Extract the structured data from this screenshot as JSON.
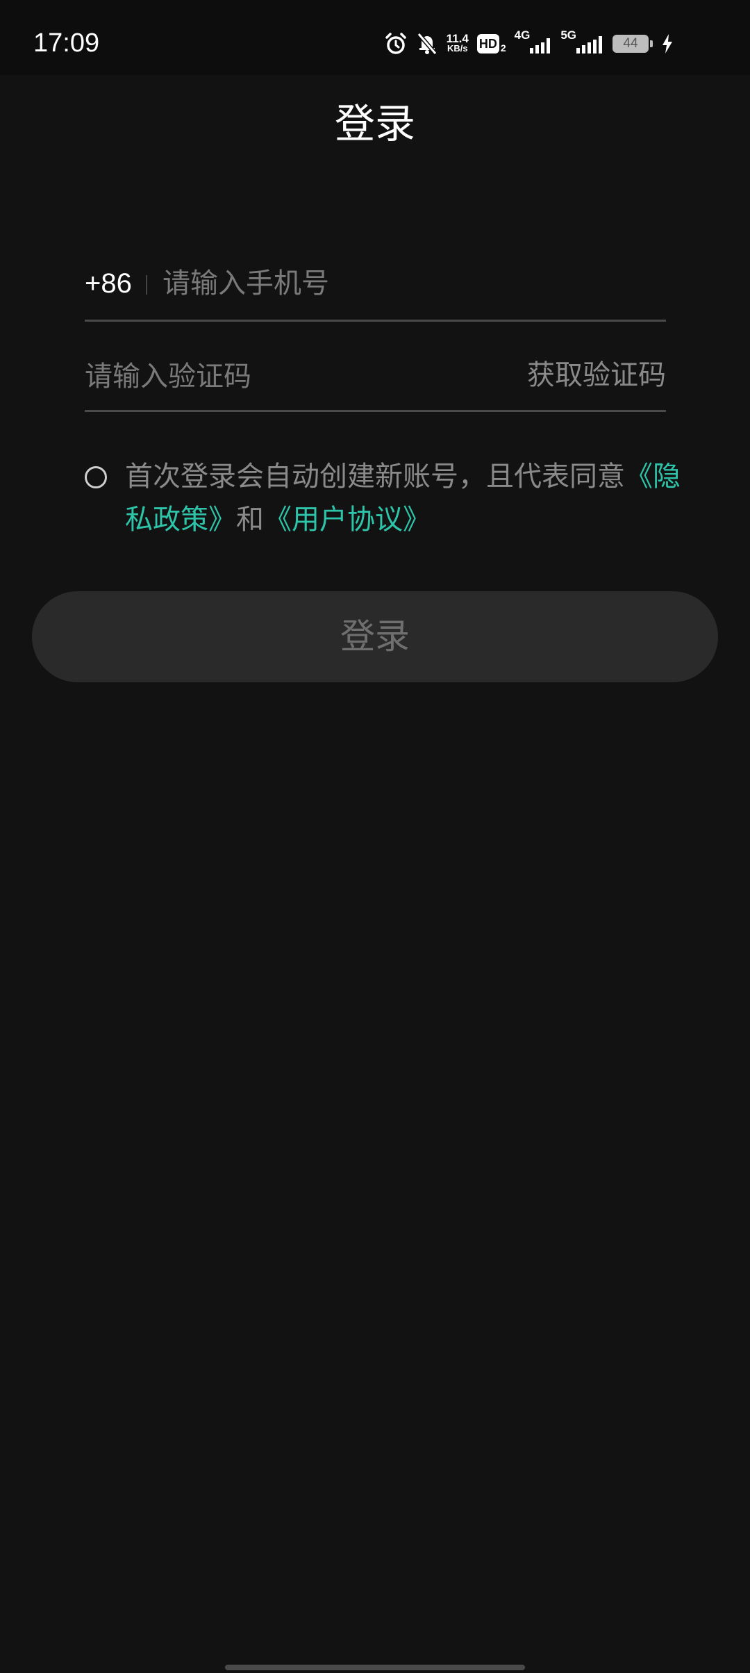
{
  "status_bar": {
    "time": "17:09",
    "net_speed_value": "11.4",
    "net_speed_unit": "KB/s",
    "hd_label": "HD",
    "hd_sub": "2",
    "sig1_label": "4G",
    "sig2_label": "5G",
    "battery_level": "44",
    "icons": [
      "alarm-icon",
      "mute-icon",
      "hd-icon",
      "signal-4g-icon",
      "signal-5g-icon",
      "battery-icon",
      "charging-icon"
    ]
  },
  "page": {
    "title": "登录"
  },
  "phone": {
    "country_code": "+86",
    "placeholder": "请输入手机号",
    "value": ""
  },
  "code": {
    "placeholder": "请输入验证码",
    "value": "",
    "get_code_label": "获取验证码"
  },
  "agreement": {
    "checked": false,
    "text_prefix": "首次登录会自动创建新账号，且代表同意",
    "privacy_link": "《隐私政策》",
    "joiner": "和",
    "terms_link": "《用户协议》"
  },
  "login_button": {
    "label": "登录"
  },
  "colors": {
    "background": "#121212",
    "link": "#2ec4a9",
    "button_bg": "#2a2a2a",
    "button_text": "#6f6f6f",
    "muted_text": "#8a8a8a"
  }
}
